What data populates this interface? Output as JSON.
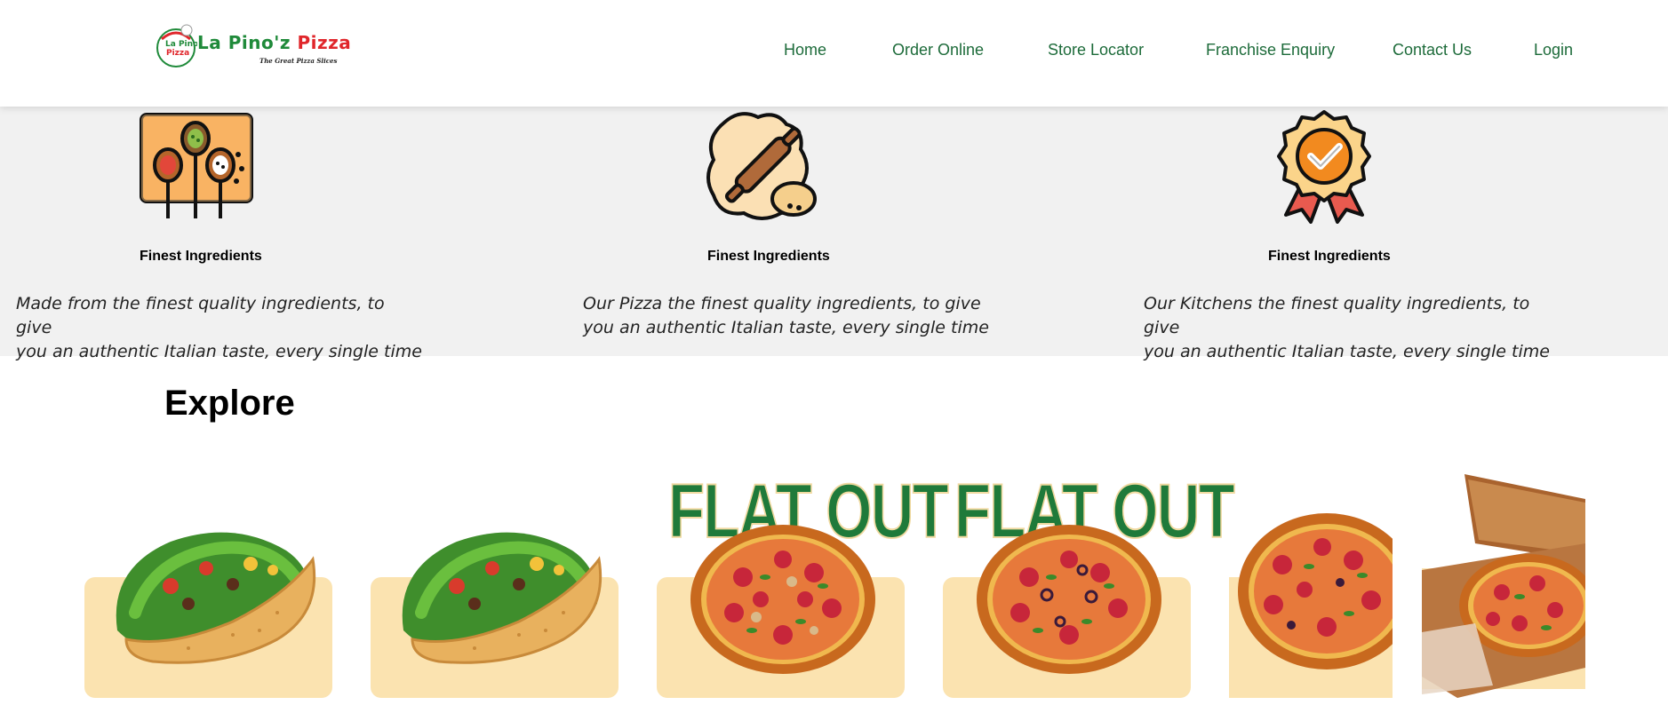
{
  "header": {
    "logo": {
      "word1": "La Pino'z",
      "word2": "Pizza",
      "tagline": "The Great Pizza Slices"
    },
    "nav": [
      {
        "label": "Home"
      },
      {
        "label": "Order Online"
      },
      {
        "label": "Store Locator"
      },
      {
        "label": "Franchise Enquiry"
      },
      {
        "label": "Contact Us"
      },
      {
        "label": "Login"
      }
    ]
  },
  "features": [
    {
      "icon": "spices-icon",
      "title": "Finest Ingredients",
      "line1": "Made from the finest quality ingredients, to give",
      "line2": "you an authentic Italian taste, every single time"
    },
    {
      "icon": "rolling-pin-dough-icon",
      "title": "Finest Ingredients",
      "line1": "Our Pizza the finest quality ingredients, to give",
      "line2": "you an authentic Italian taste, every single time"
    },
    {
      "icon": "quality-badge-icon",
      "title": "Finest Ingredients",
      "line1": "Our Kitchens the finest quality ingredients, to give",
      "line2": "you an authentic Italian taste, every single time"
    }
  ],
  "explore": {
    "title": "Explore",
    "cards": [
      {
        "image": "taco"
      },
      {
        "image": "taco"
      },
      {
        "image": "pizza",
        "overlay_text": "FLAT OUT"
      },
      {
        "image": "pizza",
        "overlay_text": "FLAT OUT"
      },
      {
        "image": "pizza"
      },
      {
        "image": "pizza-box"
      }
    ]
  },
  "colors": {
    "nav_text": "#1d6b3a",
    "band_bg": "#f1f1f1",
    "card_bg": "#fbe3b0",
    "brand_green": "#1f8a3a",
    "brand_red": "#e0262b"
  }
}
